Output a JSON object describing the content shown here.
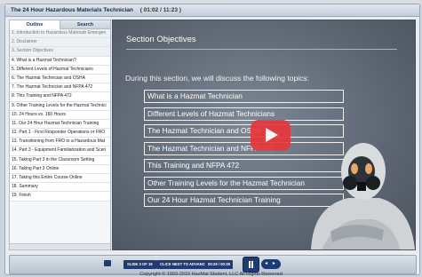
{
  "window": {
    "title": "The 24 Hour Hazardous Materials Technician",
    "timer": "( 01:02 / 11:23 )"
  },
  "sidebar": {
    "tabs": [
      "Outline",
      "Search"
    ],
    "items": [
      "1. Introduction to Hazardous Materials Emergen",
      "2. Disclaimer",
      "3. Section Objectives",
      "4. What is a Hazmat Technician?",
      "5. Different Levels of Hazmat Technicians",
      "6. The Hazmat Technician and OSHA",
      "7. The Hazmat Technician and NFPA 472",
      "8. This Training and NFPA 472",
      "9. Other Training Levels for the Hazmat Technici",
      "10. 24 Hours vs. 160 Hours",
      "11. Our 24 Hour Hazmat Technician Training",
      "12. Part 1 - First Responder Operations or FRO",
      "13. Transitioning from FRO to a Hazardous Mat",
      "14. Part 3 - Equipment Familiarization and Scen",
      "15. Taking Part 3 in the Classroom Setting",
      "16. Taking Part 3 Online",
      "17. Taking this Entire Course Online",
      "18. Summary",
      "19. Finish"
    ]
  },
  "slide": {
    "title": "Section Objectives",
    "intro": "During this section, we will discuss the following topics:",
    "topics": [
      "What is a Hazmat Technician",
      "Different Levels of Hazmat Technicians",
      "The Hazmat Technician and OSHA",
      "The Hazmat Technician and NFPA 472",
      "This Training and NFPA 472",
      "Other Training Levels for the Hazmat Technician",
      "Our 24 Hour Hazmat Technician Training"
    ]
  },
  "controls": {
    "slide_counter": "SLIDE 3 OF 19",
    "advance_label": "CLICK NEXT TO ADVANCE",
    "time": "00:29 / 00:39",
    "prev_next": "◂ ▸"
  },
  "copyright": "Copyright © 1993-2015 HazMat Student, LLC All Rights Reserved"
}
